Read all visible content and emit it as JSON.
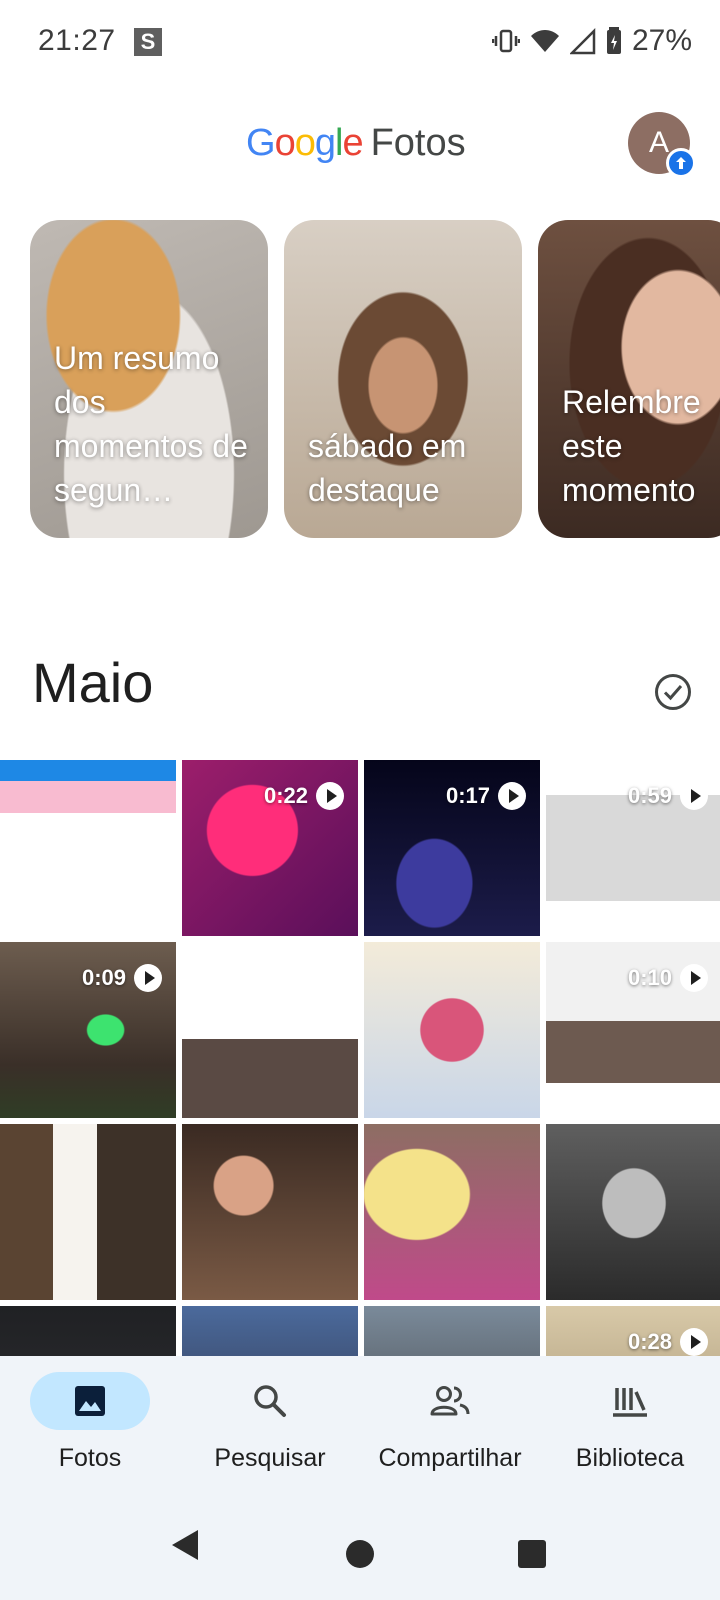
{
  "status_bar": {
    "time": "21:27",
    "notification_letter": "S",
    "battery": "27%"
  },
  "header": {
    "brand_google": [
      "G",
      "o",
      "o",
      "g",
      "l",
      "e"
    ],
    "brand_product": "Fotos",
    "avatar_initial": "A",
    "brand_colors": [
      "#4285f4",
      "#ea4335",
      "#fbbc05",
      "#4285f4",
      "#34a853",
      "#ea4335"
    ]
  },
  "memories": [
    {
      "caption": "Um resumo dos momentos de segun…"
    },
    {
      "caption": "sábado em destaque"
    },
    {
      "caption": "Relembre este momento"
    }
  ],
  "section": {
    "title": "Maio"
  },
  "grid": {
    "videos": {
      "t01": "0:22",
      "t02": "0:17",
      "t03": "0:59",
      "t10": "0:09",
      "t13": "0:10",
      "t33": "0:28"
    }
  },
  "bottom_nav": {
    "items": [
      {
        "label": "Fotos",
        "icon": "photo-icon",
        "active": true
      },
      {
        "label": "Pesquisar",
        "icon": "search-icon",
        "active": false
      },
      {
        "label": "Compartilhar",
        "icon": "people-icon",
        "active": false
      },
      {
        "label": "Biblioteca",
        "icon": "library-icon",
        "active": false
      }
    ]
  }
}
